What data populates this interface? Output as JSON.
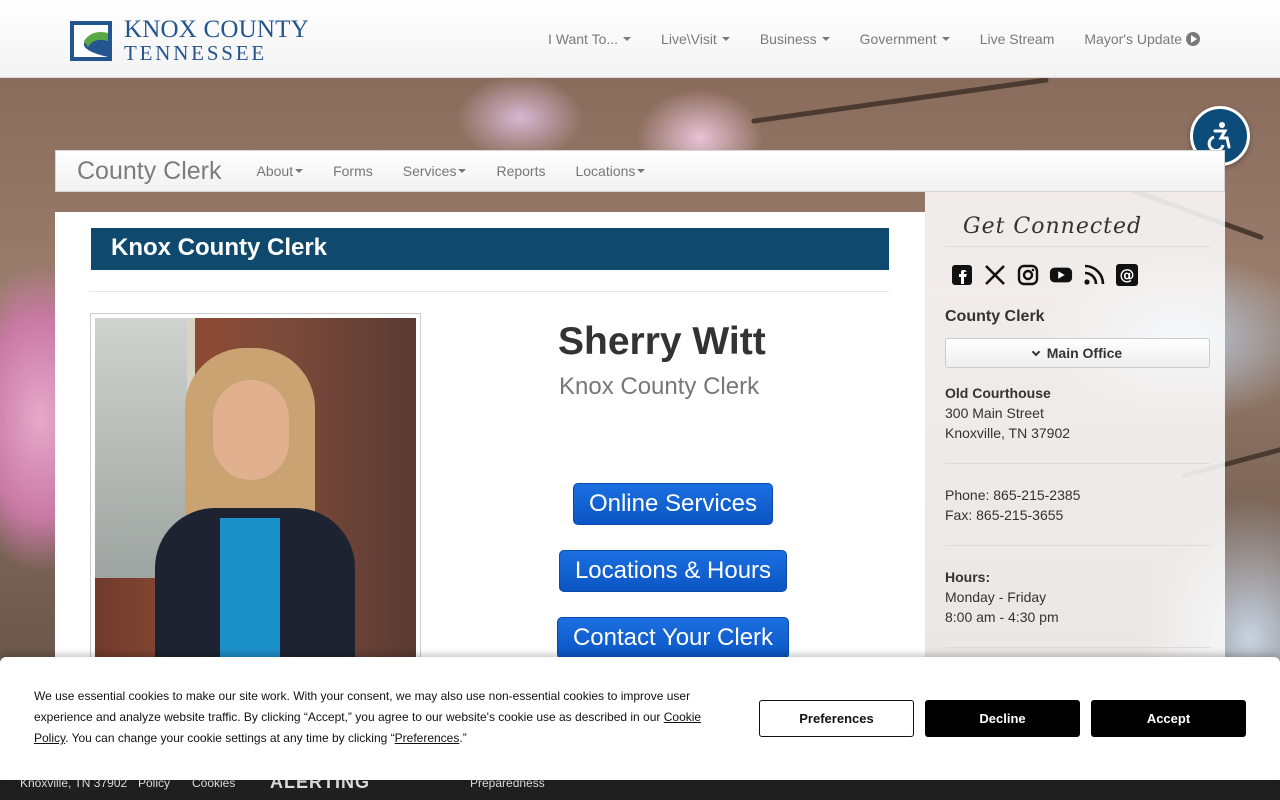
{
  "header": {
    "logo_line1": "KNOX COUNTY",
    "logo_line2": "TENNESSEE",
    "nav": [
      {
        "label": "I Want To...",
        "has_caret": true
      },
      {
        "label": "Live\\Visit",
        "has_caret": true
      },
      {
        "label": "Business",
        "has_caret": true
      },
      {
        "label": "Government",
        "has_caret": true
      },
      {
        "label": "Live Stream",
        "has_caret": false
      },
      {
        "label": "Mayor's Update",
        "has_caret": false,
        "icon": "play-circle-icon"
      }
    ]
  },
  "accessibility": {
    "icon": "wheelchair-icon"
  },
  "subnav": {
    "brand": "County Clerk",
    "items": [
      {
        "label": "About",
        "has_caret": true
      },
      {
        "label": "Forms",
        "has_caret": false
      },
      {
        "label": "Services",
        "has_caret": true
      },
      {
        "label": "Reports",
        "has_caret": false
      },
      {
        "label": "Locations",
        "has_caret": true
      }
    ]
  },
  "main": {
    "title": "Knox County Clerk",
    "person_name": "Sherry Witt",
    "person_role": "Knox County Clerk",
    "buttons": {
      "online_services": "Online Services",
      "locations_hours": "Locations & Hours",
      "contact_clerk": "Contact Your Clerk"
    }
  },
  "sidebar": {
    "get_connected": "Get Connected",
    "social_icons": [
      "facebook-icon",
      "x-icon",
      "instagram-icon",
      "youtube-icon",
      "rss-icon",
      "email-icon"
    ],
    "section_title": "County Clerk",
    "dropdown_label": "Main Office",
    "address": {
      "name": "Old Courthouse",
      "street": "300 Main Street",
      "city": "Knoxville, TN 37902"
    },
    "phone": "Phone: 865-215-2385",
    "fax": "Fax: 865-215-3655",
    "hours_label": "Hours:",
    "hours_days": "Monday - Friday",
    "hours_time": "8:00 am - 4:30 pm"
  },
  "footer": {
    "address": "Knoxville, TN 37902",
    "policy": "Policy",
    "cookies": "Cookies",
    "alerting": "ALERTING",
    "preparedness": "Preparedness"
  },
  "cookie_banner": {
    "text_part1": "We use essential cookies to make our site work. With your consent, we may also use non-essential cookies to improve user experience and analyze website traffic. By clicking “Accept,” you agree to our website's cookie use as described in our ",
    "cookie_policy_link": "Cookie Policy",
    "text_part2": ". You can change your cookie settings at any time by clicking “",
    "preferences_link": "Preferences",
    "text_part3": ".”",
    "preferences_button": "Preferences",
    "decline_button": "Decline",
    "accept_button": "Accept"
  },
  "colors": {
    "brand_blue": "#24558f",
    "title_bar": "#0f4a6e",
    "button_blue": "#0b55c4",
    "accessibility_bg": "#0c4b7a"
  }
}
